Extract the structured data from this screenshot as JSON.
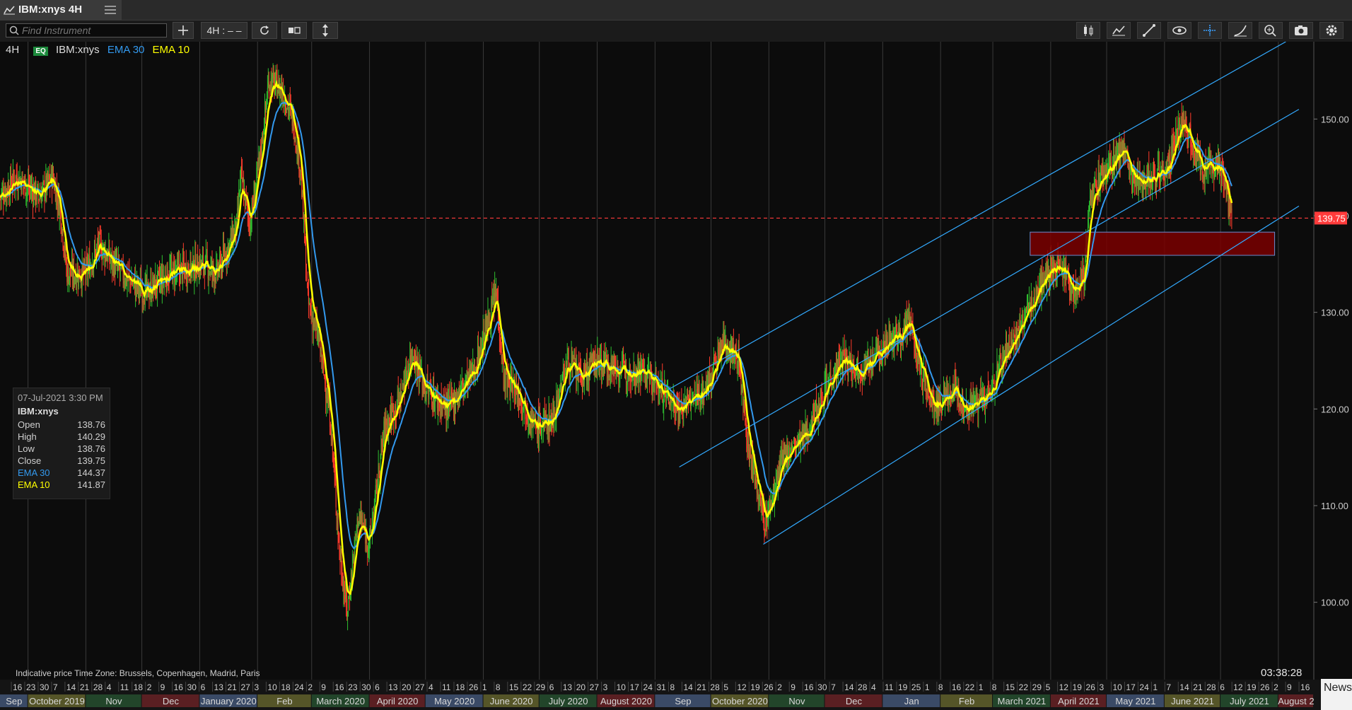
{
  "window": {
    "title": "IBM:xnys 4H"
  },
  "toolbar": {
    "search_placeholder": "Find Instrument",
    "interval_label": "4H : – –"
  },
  "legend": {
    "interval": "4H",
    "badge": "EQ",
    "symbol": "IBM:xnys",
    "ema30_label": "EMA 30",
    "ema10_label": "EMA 10"
  },
  "info_box": {
    "datetime": "07-Jul-2021 3:30 PM",
    "symbol": "IBM:xnys",
    "rows": [
      {
        "label": "Open",
        "value": "138.76"
      },
      {
        "label": "High",
        "value": "140.29"
      },
      {
        "label": "Low",
        "value": "138.76"
      },
      {
        "label": "Close",
        "value": "139.75"
      },
      {
        "label": "EMA 30",
        "value": "144.37"
      },
      {
        "label": "EMA 10",
        "value": "141.87"
      }
    ]
  },
  "footer": {
    "note": "Indicative price     Time Zone: Brussels, Copenhagen, Madrid, Paris",
    "clock": "03:38:28",
    "news_tab": "News"
  },
  "colors": {
    "ema30": "#3399ee",
    "ema10": "#ffff00",
    "up_candle": "#2fbf2f",
    "down_candle": "#ff3b2b",
    "channel": "#33aaff",
    "last_price": "#ff3b3b",
    "zone": "#7a0000"
  },
  "chart_data": {
    "type": "line",
    "title": "",
    "xlabel": "",
    "ylabel": "",
    "ylim": [
      92,
      158
    ],
    "y_ticks": [
      "100.00",
      "110.00",
      "120.00",
      "130.00",
      "140.00",
      "150.00"
    ],
    "grid": "vertical monthly lines",
    "last_price": {
      "value": 139.75,
      "label": "139.75"
    },
    "day_ticks": [
      "16",
      "23",
      "30",
      "7",
      "14",
      "21",
      "28",
      "4",
      "11",
      "18",
      "2",
      "9",
      "16",
      "30",
      "6",
      "13",
      "21",
      "27",
      "3",
      "10",
      "18",
      "24",
      "2",
      "9",
      "16",
      "23",
      "30",
      "6",
      "13",
      "20",
      "27",
      "4",
      "11",
      "18",
      "26",
      "1",
      "8",
      "15",
      "22",
      "29",
      "6",
      "13",
      "20",
      "27",
      "3",
      "10",
      "17",
      "24",
      "31",
      "8",
      "14",
      "21",
      "28",
      "5",
      "12",
      "19",
      "26",
      "2",
      "9",
      "16",
      "30",
      "7",
      "14",
      "28",
      "4",
      "11",
      "19",
      "25",
      "1",
      "8",
      "16",
      "22",
      "1",
      "8",
      "15",
      "22",
      "29",
      "5",
      "12",
      "19",
      "26",
      "3",
      "10",
      "17",
      "24",
      "1",
      "7",
      "14",
      "21",
      "28",
      "6",
      "12",
      "19",
      "26",
      "2",
      "9",
      "16"
    ],
    "months": [
      {
        "label": "Sep",
        "start": "2019-09-16",
        "end": "2019-10-01"
      },
      {
        "label": "October 2019",
        "start": "2019-10-01",
        "end": "2019-11-01"
      },
      {
        "label": "Nov",
        "start": "2019-11-01",
        "end": "2019-12-01"
      },
      {
        "label": "Dec",
        "start": "2019-12-01",
        "end": "2020-01-01"
      },
      {
        "label": "January 2020",
        "start": "2020-01-01",
        "end": "2020-02-01"
      },
      {
        "label": "Feb",
        "start": "2020-02-01",
        "end": "2020-03-01"
      },
      {
        "label": "March 2020",
        "start": "2020-03-01",
        "end": "2020-04-01"
      },
      {
        "label": "April 2020",
        "start": "2020-04-01",
        "end": "2020-05-01"
      },
      {
        "label": "May 2020",
        "start": "2020-05-01",
        "end": "2020-06-01"
      },
      {
        "label": "June 2020",
        "start": "2020-06-01",
        "end": "2020-07-01"
      },
      {
        "label": "July 2020",
        "start": "2020-07-01",
        "end": "2020-08-01"
      },
      {
        "label": "August 2020",
        "start": "2020-08-01",
        "end": "2020-09-01"
      },
      {
        "label": "Sep",
        "start": "2020-09-01",
        "end": "2020-10-01"
      },
      {
        "label": "October 2020",
        "start": "2020-10-01",
        "end": "2020-11-01"
      },
      {
        "label": "Nov",
        "start": "2020-11-01",
        "end": "2020-12-01"
      },
      {
        "label": "Dec",
        "start": "2020-12-01",
        "end": "2021-01-01"
      },
      {
        "label": "Jan",
        "start": "2021-01-01",
        "end": "2021-02-01"
      },
      {
        "label": "Feb",
        "start": "2021-02-01",
        "end": "2021-03-01"
      },
      {
        "label": "March 2021",
        "start": "2021-03-01",
        "end": "2021-04-01"
      },
      {
        "label": "April 2021",
        "start": "2021-04-01",
        "end": "2021-05-01"
      },
      {
        "label": "May 2021",
        "start": "2021-05-01",
        "end": "2021-06-01"
      },
      {
        "label": "June 2021",
        "start": "2021-06-01",
        "end": "2021-07-01"
      },
      {
        "label": "July 2021",
        "start": "2021-07-01",
        "end": "2021-08-01"
      },
      {
        "label": "August 2",
        "start": "2021-08-01",
        "end": "2021-08-20"
      }
    ],
    "x_range": [
      "2019-09-16",
      "2021-08-20"
    ],
    "price_path": [
      {
        "date": "2019-09-16",
        "close": 142
      },
      {
        "date": "2019-09-25",
        "close": 144
      },
      {
        "date": "2019-10-07",
        "close": 142
      },
      {
        "date": "2019-10-14",
        "close": 144
      },
      {
        "date": "2019-10-18",
        "close": 141
      },
      {
        "date": "2019-10-22",
        "close": 134
      },
      {
        "date": "2019-11-01",
        "close": 134
      },
      {
        "date": "2019-11-08",
        "close": 137
      },
      {
        "date": "2019-11-20",
        "close": 134
      },
      {
        "date": "2019-12-03",
        "close": 132
      },
      {
        "date": "2019-12-16",
        "close": 134
      },
      {
        "date": "2020-01-03",
        "close": 135
      },
      {
        "date": "2020-01-10",
        "close": 134
      },
      {
        "date": "2020-01-17",
        "close": 137
      },
      {
        "date": "2020-01-21",
        "close": 139
      },
      {
        "date": "2020-01-23",
        "close": 144
      },
      {
        "date": "2020-01-28",
        "close": 139
      },
      {
        "date": "2020-02-03",
        "close": 147
      },
      {
        "date": "2020-02-07",
        "close": 154
      },
      {
        "date": "2020-02-14",
        "close": 153
      },
      {
        "date": "2020-02-20",
        "close": 150
      },
      {
        "date": "2020-02-24",
        "close": 145
      },
      {
        "date": "2020-02-28",
        "close": 131
      },
      {
        "date": "2020-03-05",
        "close": 127
      },
      {
        "date": "2020-03-11",
        "close": 119
      },
      {
        "date": "2020-03-16",
        "close": 105
      },
      {
        "date": "2020-03-20",
        "close": 99
      },
      {
        "date": "2020-03-26",
        "close": 109
      },
      {
        "date": "2020-04-01",
        "close": 106
      },
      {
        "date": "2020-04-09",
        "close": 118
      },
      {
        "date": "2020-04-17",
        "close": 121
      },
      {
        "date": "2020-04-24",
        "close": 126
      },
      {
        "date": "2020-05-01",
        "close": 122
      },
      {
        "date": "2020-05-13",
        "close": 120
      },
      {
        "date": "2020-05-27",
        "close": 124
      },
      {
        "date": "2020-06-08",
        "close": 132
      },
      {
        "date": "2020-06-12",
        "close": 123
      },
      {
        "date": "2020-06-19",
        "close": 122
      },
      {
        "date": "2020-06-29",
        "close": 118
      },
      {
        "date": "2020-07-08",
        "close": 119
      },
      {
        "date": "2020-07-16",
        "close": 125
      },
      {
        "date": "2020-07-24",
        "close": 123
      },
      {
        "date": "2020-07-31",
        "close": 125
      },
      {
        "date": "2020-08-13",
        "close": 124
      },
      {
        "date": "2020-08-25",
        "close": 124
      },
      {
        "date": "2020-09-04",
        "close": 122
      },
      {
        "date": "2020-09-14",
        "close": 120
      },
      {
        "date": "2020-09-28",
        "close": 122
      },
      {
        "date": "2020-10-08",
        "close": 127
      },
      {
        "date": "2020-10-16",
        "close": 125
      },
      {
        "date": "2020-10-21",
        "close": 116
      },
      {
        "date": "2020-10-30",
        "close": 108
      },
      {
        "date": "2020-11-09",
        "close": 115
      },
      {
        "date": "2020-11-20",
        "close": 117
      },
      {
        "date": "2020-12-03",
        "close": 123
      },
      {
        "date": "2020-12-11",
        "close": 125
      },
      {
        "date": "2020-12-21",
        "close": 124
      },
      {
        "date": "2021-01-04",
        "close": 127
      },
      {
        "date": "2021-01-12",
        "close": 128
      },
      {
        "date": "2021-01-15",
        "close": 129
      },
      {
        "date": "2021-01-20",
        "close": 125
      },
      {
        "date": "2021-01-28",
        "close": 120
      },
      {
        "date": "2021-02-08",
        "close": 122
      },
      {
        "date": "2021-02-15",
        "close": 120
      },
      {
        "date": "2021-02-26",
        "close": 121
      },
      {
        "date": "2021-03-08",
        "close": 126
      },
      {
        "date": "2021-03-15",
        "close": 128
      },
      {
        "date": "2021-03-22",
        "close": 131
      },
      {
        "date": "2021-03-29",
        "close": 134
      },
      {
        "date": "2021-04-06",
        "close": 135
      },
      {
        "date": "2021-04-14",
        "close": 132
      },
      {
        "date": "2021-04-19",
        "close": 134
      },
      {
        "date": "2021-04-22",
        "close": 142
      },
      {
        "date": "2021-05-03",
        "close": 145
      },
      {
        "date": "2021-05-10",
        "close": 147
      },
      {
        "date": "2021-05-14",
        "close": 144
      },
      {
        "date": "2021-05-25",
        "close": 144
      },
      {
        "date": "2021-06-03",
        "close": 145
      },
      {
        "date": "2021-06-11",
        "close": 150
      },
      {
        "date": "2021-06-17",
        "close": 147
      },
      {
        "date": "2021-06-21",
        "close": 145
      },
      {
        "date": "2021-06-28",
        "close": 145
      },
      {
        "date": "2021-07-01",
        "close": 145
      },
      {
        "date": "2021-07-06",
        "close": 141
      },
      {
        "date": "2021-07-07",
        "close": 139.75
      }
    ],
    "channel_lines": [
      {
        "from": {
          "date": "2020-09-08",
          "value": 122
        },
        "to": {
          "date": "2021-08-05",
          "value": 158
        }
      },
      {
        "from": {
          "date": "2020-09-14",
          "value": 114
        },
        "to": {
          "date": "2021-08-12",
          "value": 151
        }
      },
      {
        "from": {
          "date": "2020-10-29",
          "value": 106
        },
        "to": {
          "date": "2021-08-12",
          "value": 141
        }
      }
    ],
    "support_zone": {
      "from": "2021-03-21",
      "to": "2021-07-30",
      "upper": 138.3,
      "lower": 135.9
    }
  }
}
